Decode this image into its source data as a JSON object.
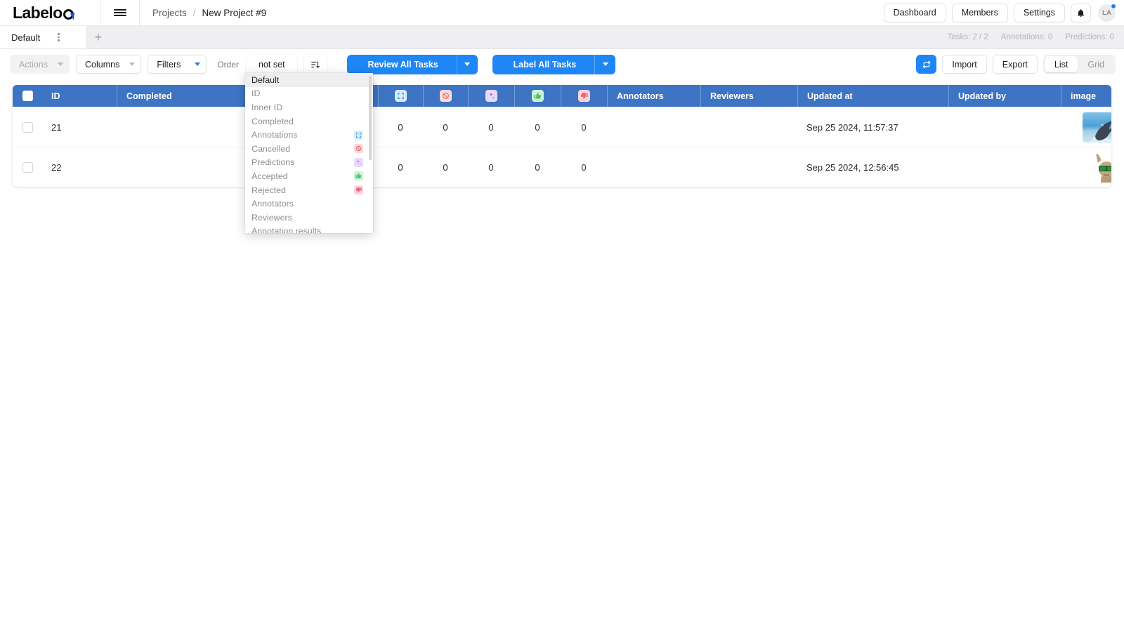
{
  "header": {
    "logo_text": "Labelo",
    "menu_icon": "hamburger-icon",
    "breadcrumb": {
      "root": "Projects",
      "separator": "/",
      "current": "New Project #9"
    },
    "buttons": [
      "Dashboard",
      "Members",
      "Settings"
    ],
    "notification_icon": "bell-icon",
    "avatar_initials": "LA"
  },
  "tabbar": {
    "tab_label": "Default",
    "add_label": "+",
    "stats": [
      "Tasks: 2 / 2",
      "Annotations: 0",
      "Predictions: 0"
    ]
  },
  "toolbar": {
    "actions_label": "Actions",
    "columns_label": "Columns",
    "filters_label": "Filters",
    "order_label": "Order",
    "order_value": "not set",
    "sort_icon": "sort-descending-icon",
    "review_all_label": "Review All Tasks",
    "label_all_label": "Label All Tasks",
    "refresh_icon": "refresh-icon",
    "import_label": "Import",
    "export_label": "Export",
    "view_list_label": "List",
    "view_grid_label": "Grid",
    "view_active": "List"
  },
  "order_menu": {
    "open": true,
    "items": [
      {
        "label": "Default",
        "selected": true,
        "icon": null
      },
      {
        "label": "ID",
        "selected": false,
        "icon": null
      },
      {
        "label": "Inner ID",
        "selected": false,
        "icon": null
      },
      {
        "label": "Completed",
        "selected": false,
        "icon": null
      },
      {
        "label": "Annotations",
        "selected": false,
        "icon": "annotations-icon"
      },
      {
        "label": "Cancelled",
        "selected": false,
        "icon": "cancelled-icon"
      },
      {
        "label": "Predictions",
        "selected": false,
        "icon": "predictions-icon"
      },
      {
        "label": "Accepted",
        "selected": false,
        "icon": "thumbs-up-icon"
      },
      {
        "label": "Rejected",
        "selected": false,
        "icon": "thumbs-down-icon"
      },
      {
        "label": "Annotators",
        "selected": false,
        "icon": null
      },
      {
        "label": "Reviewers",
        "selected": false,
        "icon": null
      },
      {
        "label": "Annotation results",
        "selected": false,
        "icon": null
      }
    ]
  },
  "table": {
    "columns": [
      {
        "key": "check",
        "label": "",
        "icon": "checkbox-icon"
      },
      {
        "key": "id",
        "label": "ID",
        "icon": null
      },
      {
        "key": "completed",
        "label": "Completed",
        "icon": null
      },
      {
        "key": "annotations",
        "label": "",
        "icon": "annotations-icon"
      },
      {
        "key": "cancelled",
        "label": "",
        "icon": "cancelled-icon"
      },
      {
        "key": "predictions",
        "label": "",
        "icon": "predictions-icon"
      },
      {
        "key": "accepted",
        "label": "",
        "icon": "thumbs-up-icon"
      },
      {
        "key": "rejected",
        "label": "",
        "icon": "thumbs-down-icon"
      },
      {
        "key": "annotators",
        "label": "Annotators",
        "icon": null
      },
      {
        "key": "reviewers",
        "label": "Reviewers",
        "icon": null
      },
      {
        "key": "updated_at",
        "label": "Updated at",
        "icon": null
      },
      {
        "key": "updated_by",
        "label": "Updated by",
        "icon": null
      },
      {
        "key": "image",
        "label": "image",
        "icon": null
      },
      {
        "key": "actions",
        "label": "",
        "icon": null
      }
    ],
    "rows": [
      {
        "id": "21",
        "completed": "",
        "annotations": "0",
        "cancelled": "0",
        "predictions": "0",
        "accepted": "0",
        "rejected": "0",
        "annotators": "",
        "reviewers": "",
        "updated_at": "Sep 25 2024, 11:57:37",
        "updated_by": "",
        "image_alt": "dolphin-jumping-photo",
        "action_icon": "code-icon"
      },
      {
        "id": "22",
        "completed": "",
        "annotations": "0",
        "cancelled": "0",
        "predictions": "0",
        "accepted": "0",
        "rejected": "0",
        "annotators": "",
        "reviewers": "",
        "updated_at": "Sep 25 2024, 12:56:45",
        "updated_by": "",
        "image_alt": "llama-with-sunglasses-photo",
        "action_icon": "code-icon"
      }
    ]
  },
  "colors": {
    "accent_blue": "#1f87f5",
    "table_header_blue": "#3d74c4",
    "logo_cursor_blue": "#1f4cf5",
    "muted_text": "#8d8d93"
  }
}
